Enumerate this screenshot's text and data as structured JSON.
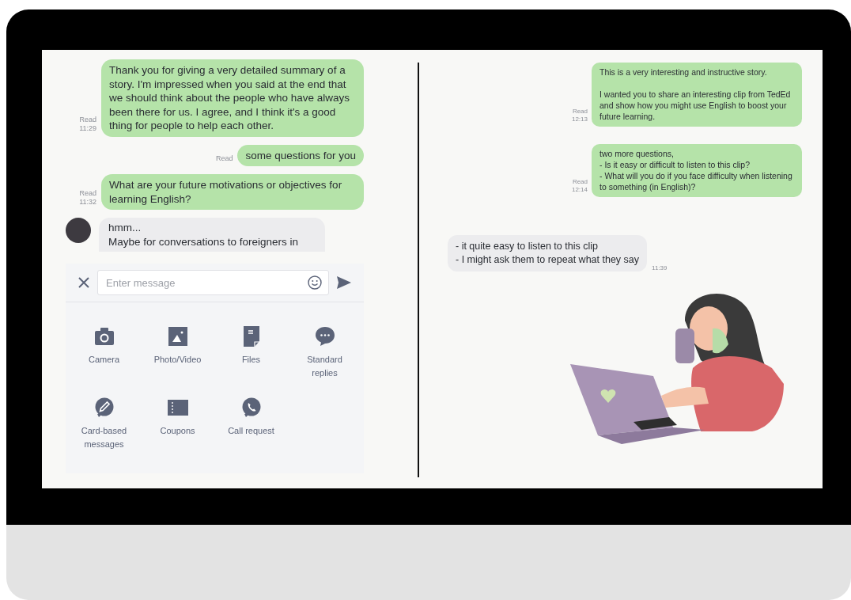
{
  "left_chat": {
    "messages": [
      {
        "kind": "sent",
        "text": "Thank you for giving a very detailed summary of a story. I'm impressed when you said at the end that we should think about the people who have always been there for us. I agree, and I think it's a good thing for people to help each other.",
        "read": "Read",
        "time": "11:29"
      },
      {
        "kind": "sent",
        "text": "some questions for you",
        "read": "Read"
      },
      {
        "kind": "sent",
        "text": "What are your future motivations or objectives for learning English?",
        "read": "Read",
        "time": "11:32"
      },
      {
        "kind": "received",
        "text": "hmm...\nMaybe for conversations to foreigners in"
      }
    ]
  },
  "composer": {
    "placeholder": "Enter message"
  },
  "attachments": [
    {
      "kind": "camera",
      "label": "Camera"
    },
    {
      "kind": "photo",
      "label": "Photo/Video"
    },
    {
      "kind": "files",
      "label": "Files"
    },
    {
      "kind": "replies",
      "label": "Standard\nreplies"
    },
    {
      "kind": "card",
      "label": "Card-based\nmessages"
    },
    {
      "kind": "coupon",
      "label": "Coupons"
    },
    {
      "kind": "call",
      "label": "Call request"
    }
  ],
  "right_chat": {
    "messages": [
      {
        "kind": "sent",
        "text": "This is a very interesting and instructive story.\n\nI wanted you to share an interesting clip from TedEd and show how you might use English to boost your future learning.",
        "read": "Read",
        "time": "12:13"
      },
      {
        "kind": "sent",
        "text": "two more questions,\n- Is it easy or difficult to listen to this clip?\n- What will you do if you face difficulty when listening to something (in English)?",
        "read": "Read",
        "time": "12:14"
      },
      {
        "kind": "received",
        "text": "- it quite easy to listen to this clip\n- I might ask them to repeat  what they say",
        "time": "11:39"
      }
    ]
  }
}
